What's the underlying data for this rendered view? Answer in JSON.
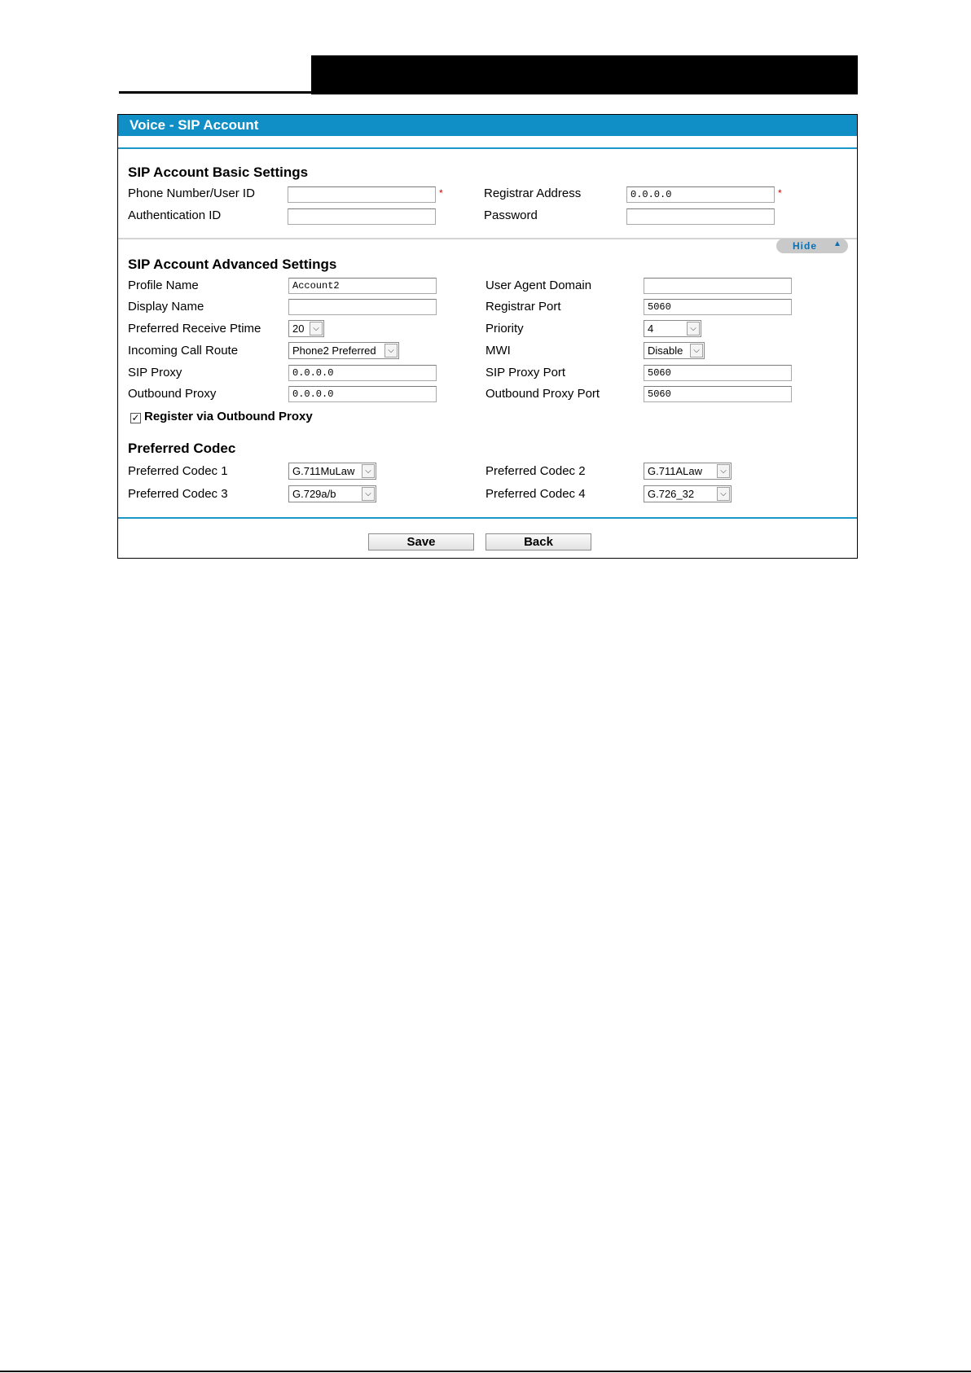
{
  "panel": {
    "title": "Voice - SIP Account"
  },
  "basic": {
    "title": "SIP Account Basic Settings",
    "phone_label": "Phone Number/User ID",
    "phone_value": "",
    "registrar_label": "Registrar Address",
    "registrar_value": "0.0.0.0",
    "auth_label": "Authentication ID",
    "auth_value": "",
    "password_label": "Password",
    "password_value": "",
    "required_mark": "*"
  },
  "hide_toggle": {
    "label": "Hide",
    "arrow": "▲"
  },
  "advanced": {
    "title": "SIP Account Advanced Settings",
    "profile_label": "Profile Name",
    "profile_value": "Account2",
    "ua_domain_label": "User Agent Domain",
    "ua_domain_value": "",
    "display_label": "Display Name",
    "display_value": "",
    "reg_port_label": "Registrar Port",
    "reg_port_value": "5060",
    "ptime_label": "Preferred Receive Ptime",
    "ptime_value": "20",
    "priority_label": "Priority",
    "priority_value": "4",
    "incoming_label": "Incoming Call Route",
    "incoming_value": "Phone2 Preferred",
    "mwi_label": "MWI",
    "mwi_value": "Disable",
    "sip_proxy_label": "SIP Proxy",
    "sip_proxy_value": "0.0.0.0",
    "sip_proxy_port_label": "SIP Proxy Port",
    "sip_proxy_port_value": "5060",
    "outbound_label": "Outbound Proxy",
    "outbound_value": "0.0.0.0",
    "outbound_port_label": "Outbound Proxy Port",
    "outbound_port_value": "5060",
    "register_outbound_label": "Register via Outbound Proxy",
    "register_outbound_checked": true
  },
  "codec": {
    "title": "Preferred Codec",
    "c1_label": "Preferred Codec 1",
    "c1_value": "G.711MuLaw",
    "c2_label": "Preferred Codec 2",
    "c2_value": "G.711ALaw",
    "c3_label": "Preferred Codec 3",
    "c3_value": "G.729a/b",
    "c4_label": "Preferred Codec 4",
    "c4_value": "G.726_32"
  },
  "actions": {
    "save": "Save",
    "back": "Back"
  },
  "icons": {
    "dropdown": "chevron-down-icon",
    "checkbox": "check-icon"
  }
}
